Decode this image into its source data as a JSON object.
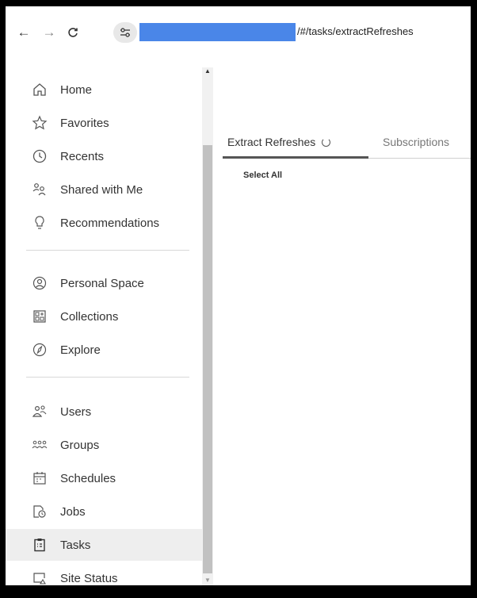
{
  "browser": {
    "url_path": "/#/tasks/extractRefreshes",
    "back_icon": "arrow-left-icon",
    "forward_icon": "arrow-right-icon",
    "reload_icon": "reload-icon",
    "site_info_icon": "tune-icon",
    "redaction_color": "#4a86e8"
  },
  "sidebar": {
    "items": [
      {
        "label": "Home",
        "icon": "home-icon"
      },
      {
        "label": "Favorites",
        "icon": "star-icon"
      },
      {
        "label": "Recents",
        "icon": "clock-icon"
      },
      {
        "label": "Shared with Me",
        "icon": "shared-icon"
      },
      {
        "label": "Recommendations",
        "icon": "lightbulb-icon"
      },
      {
        "label": "Personal Space",
        "icon": "person-circle-icon"
      },
      {
        "label": "Collections",
        "icon": "grid-plus-icon"
      },
      {
        "label": "Explore",
        "icon": "compass-icon"
      },
      {
        "label": "Users",
        "icon": "users-icon"
      },
      {
        "label": "Groups",
        "icon": "groups-icon"
      },
      {
        "label": "Schedules",
        "icon": "calendar-icon"
      },
      {
        "label": "Jobs",
        "icon": "jobs-icon"
      },
      {
        "label": "Tasks",
        "icon": "clipboard-icon",
        "active": true
      },
      {
        "label": "Site Status",
        "icon": "site-status-icon"
      }
    ]
  },
  "main": {
    "tabs": [
      {
        "label": "Extract Refreshes",
        "active": true,
        "loading": true
      },
      {
        "label": "Subscriptions"
      }
    ],
    "select_all": "Select All"
  },
  "colors": {
    "active_item_bg": "#eeeeee",
    "tab_underline": "#555555"
  }
}
